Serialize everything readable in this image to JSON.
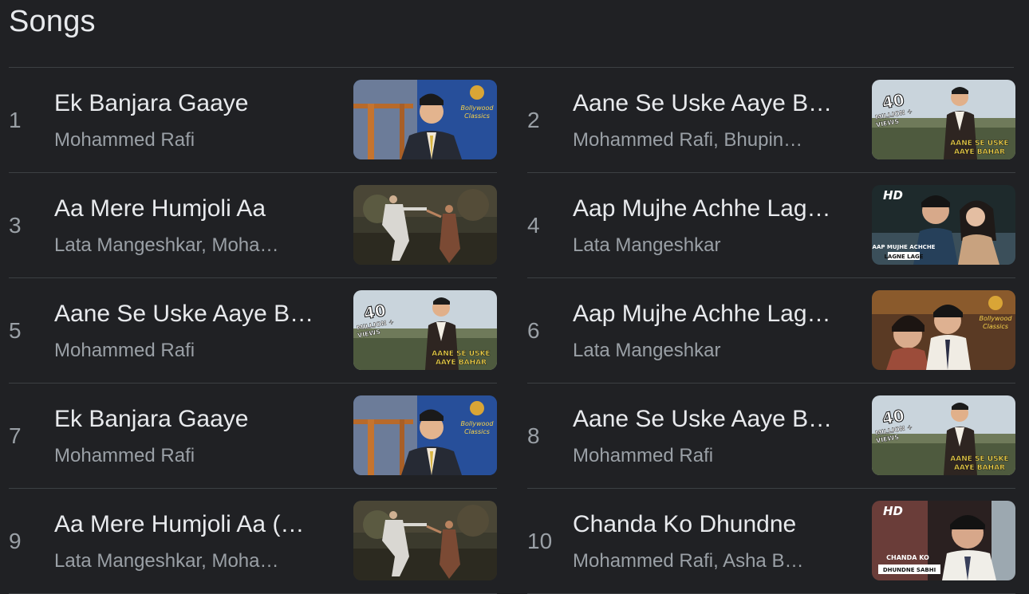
{
  "header": {
    "title": "Songs"
  },
  "songs": [
    {
      "rank": "1",
      "title": "Ek Banjara Gaaye",
      "artist": "Mohammed Rafi",
      "thumb": {
        "kind": "banjara"
      }
    },
    {
      "rank": "2",
      "title": "Aane Se Uske Aaye B…",
      "artist": "Mohammed Rafi, Bhupin…",
      "thumb": {
        "kind": "aane",
        "badge": "40",
        "badge_sub": "MILLION + VIEWS",
        "caption": "AANE SE USKE AAYE BAHAR"
      }
    },
    {
      "rank": "3",
      "title": "Aa Mere Humjoli Aa",
      "artist": "Lata Mangeshkar, Moha…",
      "thumb": {
        "kind": "humjoli"
      }
    },
    {
      "rank": "4",
      "title": "Aap Mujhe Achhe Lag…",
      "artist": "Lata Mangeshkar",
      "thumb": {
        "kind": "achhe-hd",
        "hd": "HD",
        "caption": "AAP MUJHE ACHCHE LAGNE LAGE"
      }
    },
    {
      "rank": "5",
      "title": "Aane Se Uske Aaye B…",
      "artist": "Mohammed Rafi",
      "thumb": {
        "kind": "aane",
        "badge": "40",
        "badge_sub": "MILLION + VIEWS",
        "caption": "AANE SE USKE AAYE BAHAR"
      }
    },
    {
      "rank": "6",
      "title": "Aap Mujhe Achhe Lag…",
      "artist": "Lata Mangeshkar",
      "thumb": {
        "kind": "achhe"
      }
    },
    {
      "rank": "7",
      "title": "Ek Banjara Gaaye",
      "artist": "Mohammed Rafi",
      "thumb": {
        "kind": "banjara"
      }
    },
    {
      "rank": "8",
      "title": "Aane Se Uske Aaye B…",
      "artist": "Mohammed Rafi",
      "thumb": {
        "kind": "aane",
        "badge": "40",
        "badge_sub": "MILLION + VIEWS",
        "caption": "AANE SE USKE AAYE BAHAR"
      }
    },
    {
      "rank": "9",
      "title": "Aa Mere Humjoli Aa (…",
      "artist": "Lata Mangeshkar, Moha…",
      "thumb": {
        "kind": "humjoli"
      }
    },
    {
      "rank": "10",
      "title": "Chanda Ko Dhundne",
      "artist": "Mohammed Rafi, Asha B…",
      "thumb": {
        "kind": "chanda",
        "hd": "HD",
        "caption": "CHANDA KO DHUNDNE SABHI"
      }
    }
  ]
}
